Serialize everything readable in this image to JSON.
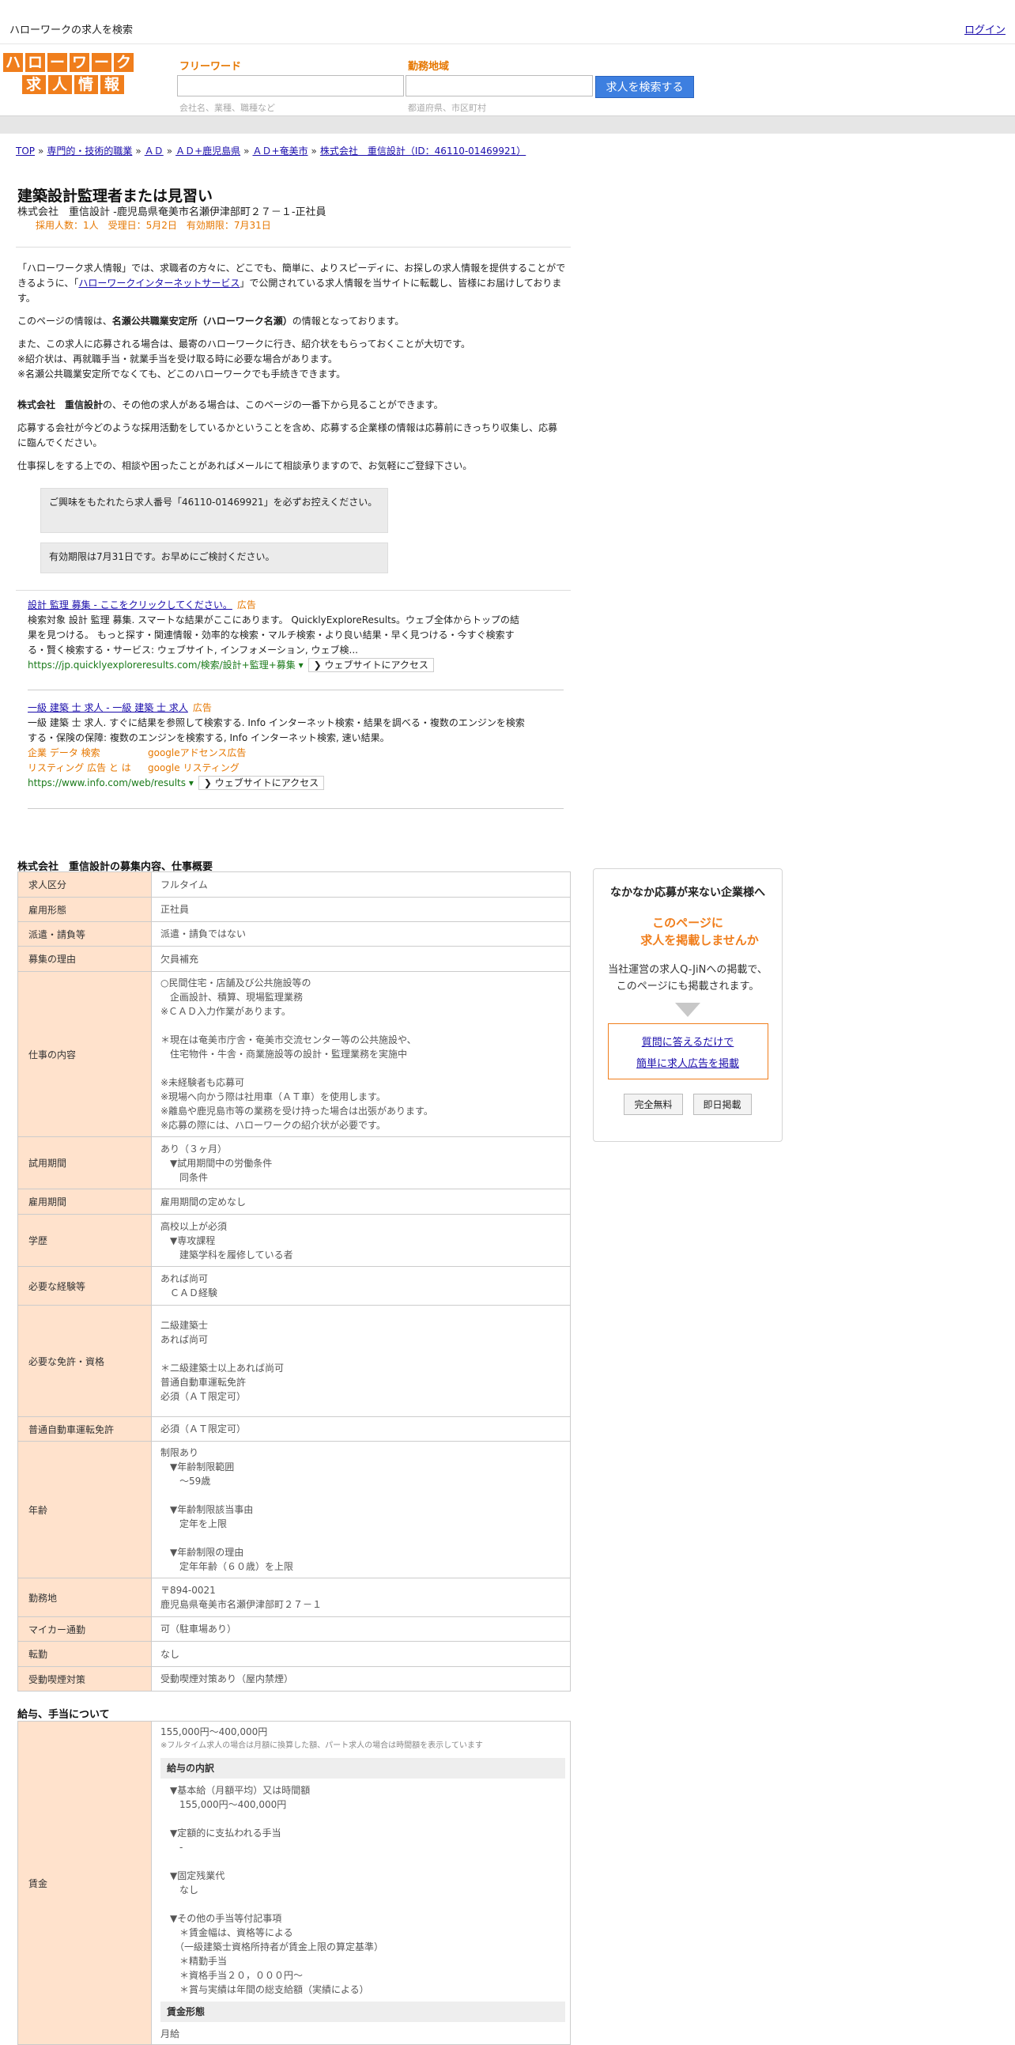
{
  "topbar": {
    "title": "ハローワークの求人を検索",
    "login": "ログイン"
  },
  "header": {
    "logo_row1": [
      "ハ",
      "ロ",
      "ー",
      "ワ",
      "ー",
      "ク"
    ],
    "logo_row2": [
      "求",
      "人",
      "情",
      "報"
    ],
    "freeword_label": "フリーワード",
    "area_label": "勤務地域",
    "freeword_placeholder": "会社名、業種、職種など",
    "area_placeholder": "都道府県、市区町村",
    "search_button": "求人を検索する"
  },
  "breadcrumb": [
    "TOP",
    "専門的・技術的職業",
    "ＡＤ",
    "ＡＤ+鹿児島県",
    "ＡＤ+奄美市",
    "株式会社　重信設計（ID：46110-01469921）"
  ],
  "job": {
    "title": "建築設計監理者または見習い",
    "company_line": "株式会社　重信設計 -鹿児島県奄美市名瀬伊津部町２７－１-正社員",
    "meta": "採用人数：1人　受理日：5月2日　有効期限：7月31日"
  },
  "intro": {
    "p1_a": "「ハローワーク求人情報」では、求職者の方々に、どこでも、簡単に、よりスピーディに、お探しの求人情報を提供することができるように、「",
    "p1_link": "ハローワークインターネットサービス",
    "p1_b": "」で公開されている求人情報を当サイトに転載し、皆様にお届けしております。",
    "p2_a": "このページの情報は、",
    "p2_b": "名瀬公共職業安定所（ハローワーク名瀬）",
    "p2_c": "の情報となっております。",
    "p3_l1": "また、この求人に応募される場合は、最寄のハローワークに行き、紹介状をもらっておくことが大切です。",
    "p3_l2": "※紹介状は、再就職手当・就業手当を受け取る時に必要な場合があります。",
    "p3_l3": "※名瀬公共職業安定所でなくても、どこのハローワークでも手続きできます。",
    "p4_a": "株式会社　重信設計",
    "p4_b": "の、その他の求人がある場合は、このページの一番下から見ることができます。",
    "p5": "応募する会社が今どのような採用活動をしているかということを含め、応募する企業様の情報は応募前にきっちり収集し、応募に臨んでください。",
    "p6": "仕事探しをする上での、相談や困ったことがあればメールにて相談承りますので、お気軽にご登録下さい。"
  },
  "notice": {
    "box1": "ご興味をもたれたら求人番号「46110-01469921」を必ずお控えください。",
    "box2": "有効期限は7月31日です。お早めにご検討ください。"
  },
  "ads": [
    {
      "title": "設計 監理 募集 - ここをクリックしてください。",
      "tag": "広告",
      "body": "検索対象 設計 監理 募集. スマートな結果がここにあります。 QuicklyExploreResults。ウェブ全体からトップの結果を見つける。 もっと探す・関連情報・効率的な検索・マルチ検索・より良い結果・早く見つける・今すぐ検索する・賢く検索する・サービス: ウェブサイト, インフォメーション, ウェブ検...",
      "url": "https://jp.quicklyexploreresults.com/検索/設計+監理+募集 ▾",
      "visit": "❯ ウェブサイトにアクセス"
    },
    {
      "title": "一級 建築 士 求人 - 一級 建築 士 求人",
      "tag": "広告",
      "body": "一級 建築 士 求人. すぐに結果を参照して検索する. Info インターネット検索・結果を調べる・複数のエンジンを検索する・保険の保障: 複数のエンジンを検索する, Info インターネット検索, 速い結果。",
      "sublinks": [
        "企業 データ 検索",
        "googleアドセンス広告",
        "リスティング 広告 と は",
        "google リスティング"
      ],
      "url": "https://www.info.com/web/results ▾",
      "visit": "❯ ウェブサイトにアクセス"
    }
  ],
  "section1": {
    "heading": "株式会社　重信設計の募集内容、仕事概要",
    "rows": [
      {
        "k": "求人区分",
        "v": "フルタイム"
      },
      {
        "k": "雇用形態",
        "v": "正社員"
      },
      {
        "k": "派遣・請負等",
        "v": "派遣・請負ではない"
      },
      {
        "k": "募集の理由",
        "v": "欠員補充"
      },
      {
        "k": "仕事の内容",
        "v": "○民間住宅・店舗及び公共施設等の\n　企画設計、積算、現場監理業務\n※ＣＡＤ入力作業があります。\n\n＊現在は奄美市庁舎・奄美市交流センター等の公共施設や、\n　住宅物件・牛舎・商業施設等の設計・監理業務を実施中\n\n※未経験者も応募可\n※現場へ向かう際は社用車（ＡＴ車）を使用します。\n※離島や鹿児島市等の業務を受け持った場合は出張があります。\n※応募の際には、ハローワークの紹介状が必要です。"
      },
      {
        "k": "試用期間",
        "v": "あり（３ヶ月）\n　▼試用期間中の労働条件\n　　同条件"
      },
      {
        "k": "雇用期間",
        "v": "雇用期間の定めなし"
      },
      {
        "k": "学歴",
        "v": "高校以上が必須\n　▼専攻課程\n　　建築学科を履修している者"
      },
      {
        "k": "必要な経験等",
        "v": "あれば尚可\n　ＣＡＤ経験"
      },
      {
        "k": "必要な免許・資格",
        "v": "二級建築士\nあれば尚可\n\n＊二級建築士以上あれば尚可\n普通自動車運転免許\n必須（ＡＴ限定可）\n"
      },
      {
        "k": "普通自動車運転免許",
        "v": "必須（ＡＴ限定可）"
      },
      {
        "k": "年齢",
        "v": "制限あり\n　▼年齢制限範囲\n　　〜59歳\n\n　▼年齢制限該当事由\n　　定年を上限\n\n　▼年齢制限の理由\n　　定年年齢（６０歳）を上限"
      },
      {
        "k": "勤務地",
        "v": "〒894-0021\n鹿児島県奄美市名瀬伊津部町２７－１"
      },
      {
        "k": "マイカー通勤",
        "v": "可（駐車場あり）"
      },
      {
        "k": "転勤",
        "v": "なし"
      },
      {
        "k": "受動喫煙対策",
        "v": "受動喫煙対策あり（屋内禁煙）"
      }
    ]
  },
  "section2": {
    "heading": "給与、手当について",
    "key": "賃金",
    "range": "155,000円〜400,000円",
    "note": "※フルタイム求人の場合は月額に換算した額、パート求人の場合は時間額を表示しています",
    "breakdown_title": "給与の内訳",
    "breakdown": "　▼基本給（月額平均）又は時間額\n　　155,000円〜400,000円\n\n　▼定額的に支払われる手当\n　　-\n\n　▼固定残業代\n　　なし\n\n　▼その他の手当等付記事項\n　　＊賃金幅は、資格等による\n　　（一級建築士資格所持者が賃金上限の算定基準）\n　　＊精勤手当\n　　＊資格手当２０，０００円〜\n　　＊賞与実績は年間の総支給額（実績による）",
    "form_title": "賃金形態",
    "form_value": "月給"
  },
  "aside": {
    "heading": "なかなか応募が来ない企業様へ",
    "offer_l1": "このページに",
    "offer_l2": "求人を掲載しませんか",
    "desc_l1": "当社運営の求人Q-JiNへの掲載で、",
    "desc_l2": "このページにも掲載されます。",
    "link1": "質問に答えるだけで",
    "link2": "簡単に求人広告を掲載",
    "btn1": "完全無料",
    "btn2": "即日掲載"
  }
}
